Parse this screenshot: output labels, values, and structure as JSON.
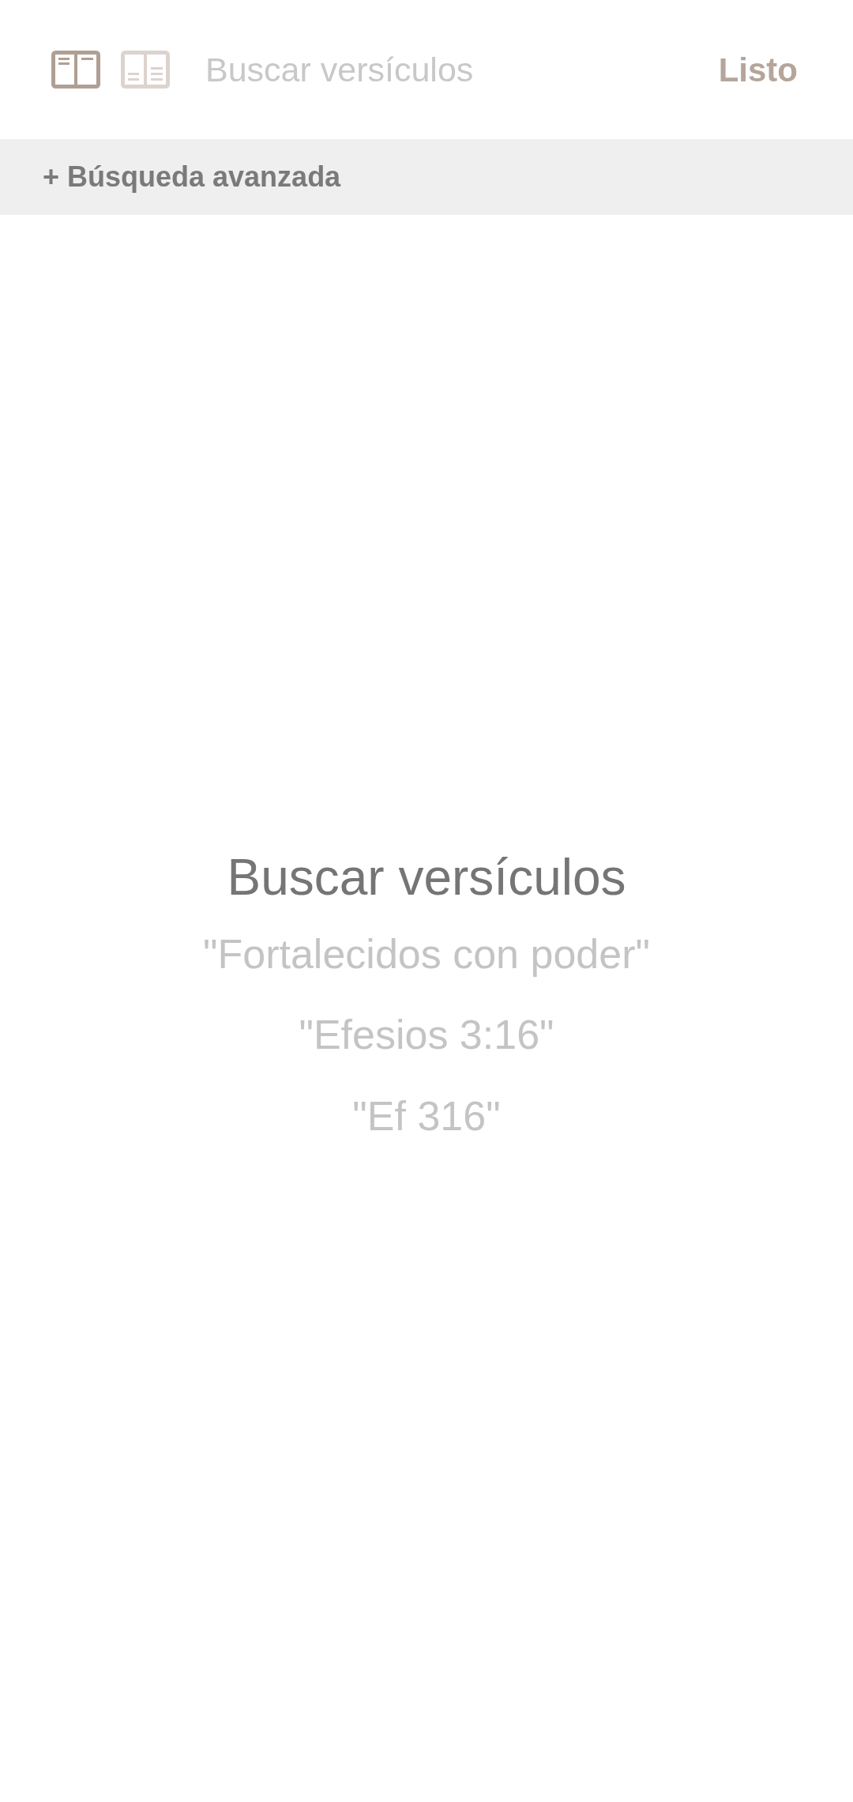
{
  "header": {
    "layouts": [
      {
        "kind": "top",
        "selected": true
      },
      {
        "kind": "bottom",
        "selected": false
      }
    ],
    "search": {
      "placeholder": "Buscar versículos"
    },
    "done_button": "Listo"
  },
  "advanced_search": "+ Búsqueda avanzada",
  "empty_state": {
    "title": "Buscar versículos",
    "examples": [
      "\"Fortalecidos con poder\"",
      "\"Efesios 3:16\"",
      "\"Ef 316\""
    ]
  }
}
